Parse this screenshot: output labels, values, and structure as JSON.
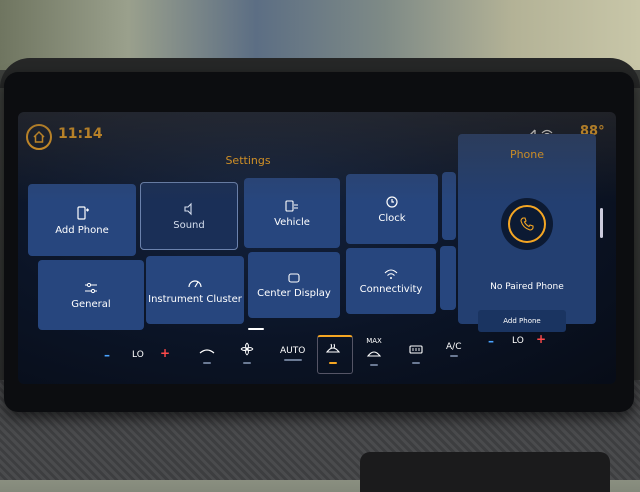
{
  "status": {
    "time": "11:14",
    "temperature": "88°"
  },
  "settings": {
    "title": "Settings",
    "tiles": [
      {
        "label": "Add Phone"
      },
      {
        "label": "Sound"
      },
      {
        "label": "Vehicle"
      },
      {
        "label": "Clock"
      },
      {
        "label": "General"
      },
      {
        "label": "Instrument Cluster"
      },
      {
        "label": "Center Display"
      },
      {
        "label": "Connectivity"
      }
    ]
  },
  "phone": {
    "title": "Phone",
    "status": "No Paired Phone",
    "button": "Add Phone"
  },
  "climate": {
    "left_temp": "LO",
    "right_temp": "LO",
    "auto_label": "AUTO",
    "max_label": "MAX",
    "ac_label": "A/C",
    "minus": "–",
    "plus": "+"
  },
  "colors": {
    "accent": "#f5a623",
    "tile": "#27467e",
    "screen": "#0b1426"
  }
}
